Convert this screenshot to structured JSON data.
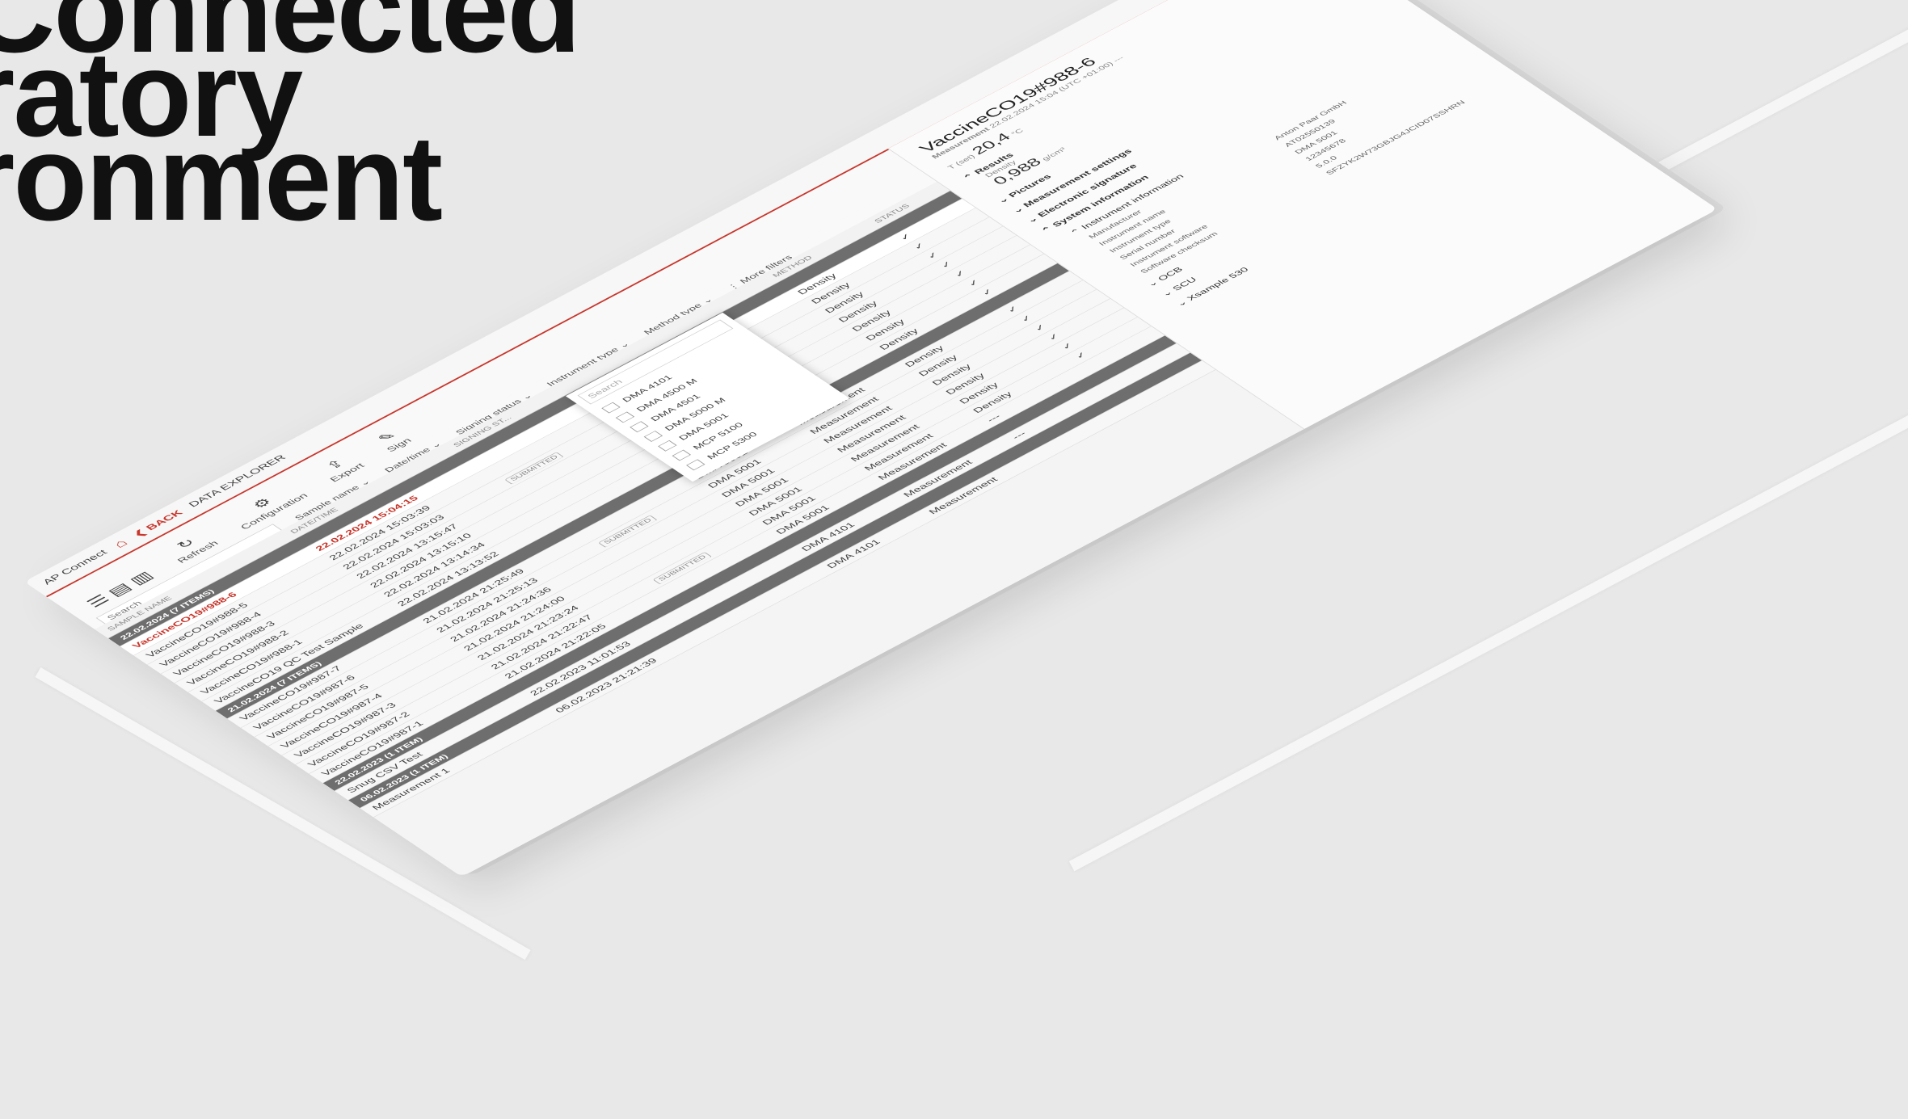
{
  "headline": [
    "Connected",
    "ratory",
    "ronment"
  ],
  "app": {
    "name": "AP Connect",
    "back": "BACK",
    "section": "DATA EXPLORER"
  },
  "toolbar": {
    "refresh": "Refresh",
    "configuration": "Configuration",
    "export": "Export",
    "sign": "Sign"
  },
  "filters": {
    "search_placeholder": "Search",
    "sample_name": "Sample name",
    "date_time": "Date/time",
    "signing_status": "Signing status",
    "instrument_type": "Instrument type",
    "method_type": "Method type",
    "more_filters": "More filters"
  },
  "columns": {
    "sample_name": "SAMPLE NAME",
    "date_time": "DATE/TIME",
    "signing_status": "SIGNING ST...",
    "method": "METHOD",
    "status": "STATUS"
  },
  "rows": [
    {
      "group": "22.02.2024 (7 ITEMS)"
    },
    {
      "name": "VaccineCO19#988-6",
      "date": "22.02.2024 15:04:15",
      "sel": true,
      "method": "Density",
      "status": "✓"
    },
    {
      "name": "VaccineCO19#988-5",
      "date": "22.02.2024 15:03:39",
      "method": "Density",
      "status": "✓"
    },
    {
      "name": "VaccineCO19#988-4",
      "date": "22.02.2024 15:03:03",
      "badge": "SUBMITTED",
      "method": "Density",
      "status": "✓"
    },
    {
      "name": "VaccineCO19#988-3",
      "date": "22.02.2024 13:15:47",
      "method": "Density",
      "status": "✓"
    },
    {
      "name": "VaccineCO19#988-2",
      "date": "22.02.2024 13:15:10",
      "method": "Density",
      "status": "✓"
    },
    {
      "name": "VaccineCO19#988-1",
      "date": "22.02.2024 13:14:34",
      "method": "Density",
      "status": "✓"
    },
    {
      "name": "VaccineCO19 QC Test Sample",
      "date": "22.02.2024 13:13:52",
      "method": "Density",
      "status": "✓"
    },
    {
      "group": "21.02.2024 (7 ITEMS)"
    },
    {
      "name": "VaccineCO19#987-7",
      "date": "21.02.2024 21:25:49",
      "instr": "DMA 5001",
      "type": "Measurement",
      "method": "Density",
      "status": "✓"
    },
    {
      "name": "VaccineCO19#987-6",
      "date": "21.02.2024 21:25:13",
      "badge": "SUBMITTED",
      "instr": "DMA 5001",
      "type": "Measurement",
      "method": "Density",
      "status": "✓"
    },
    {
      "name": "VaccineCO19#987-5",
      "date": "21.02.2024 21:24:36",
      "instr": "DMA 5001",
      "type": "Measurement",
      "method": "Density",
      "status": "✓"
    },
    {
      "name": "VaccineCO19#987-4",
      "date": "21.02.2024 21:24:00",
      "instr": "DMA 5001",
      "type": "Measurement",
      "method": "Density",
      "status": "✓"
    },
    {
      "name": "VaccineCO19#987-3",
      "date": "21.02.2024 21:23:24",
      "instr": "DMA 5001",
      "type": "Measurement",
      "method": "Density",
      "status": "✓"
    },
    {
      "name": "VaccineCO19#987-2",
      "date": "21.02.2024 21:22:47",
      "badge": "SUBMITTED",
      "instr": "DMA 5001",
      "type": "Measurement",
      "method": "Density",
      "status": "✓"
    },
    {
      "name": "VaccineCO19#987-1",
      "date": "21.02.2024 21:22:05",
      "instr": "DMA 5001",
      "type": "Measurement",
      "method": "---",
      "status": ""
    },
    {
      "group": "22.02.2023 (1 ITEM)"
    },
    {
      "name": "Snug CSV Test",
      "date": "22.02.2023 11:01:53",
      "instr": "DMA 4101",
      "type": "Measurement",
      "method": "---",
      "status": ""
    },
    {
      "group": "06.02.2023 (1 ITEM)"
    },
    {
      "name": "Measurement 1",
      "date": "06.02.2023 21:21:39",
      "instr": "DMA 4101",
      "type": "Measurement",
      "method": "",
      "status": ""
    }
  ],
  "dropdown": {
    "search": "Search",
    "items": [
      "DMA 4101",
      "DMA 4500 M",
      "DMA 4501",
      "DMA 5000 M",
      "DMA 5001",
      "MCP 5100",
      "MCP 5300"
    ]
  },
  "detail": {
    "title": "VaccineCO19#988-6",
    "type": "Measurement",
    "timestamp": "22.02.2024 15:04 (UTC +01:00) ---",
    "t_label": "T (set)",
    "t_value": "20,4",
    "t_unit": "°C",
    "results": "Results",
    "density_label": "Density",
    "density_value": "0,988",
    "density_unit": "g/cm³",
    "pictures": "Pictures",
    "measurement_settings": "Measurement settings",
    "electronic_signature": "Electronic signature",
    "system_information": "System information",
    "instrument_information": "Instrument information",
    "info": [
      {
        "k": "Manufacturer",
        "v": "Anton Paar GmbH"
      },
      {
        "k": "Instrument name",
        "v": "AT02550139"
      },
      {
        "k": "Instrument type",
        "v": "DMA 5001"
      },
      {
        "k": "Serial number",
        "v": "12345678"
      },
      {
        "k": "Instrument software",
        "v": "5.0.0"
      },
      {
        "k": "Software checksum",
        "v": "SFZYK2W73GBJG4JCID07SSHRN"
      }
    ],
    "sub": [
      "OCB",
      "SCU",
      "Xsample 530"
    ]
  }
}
